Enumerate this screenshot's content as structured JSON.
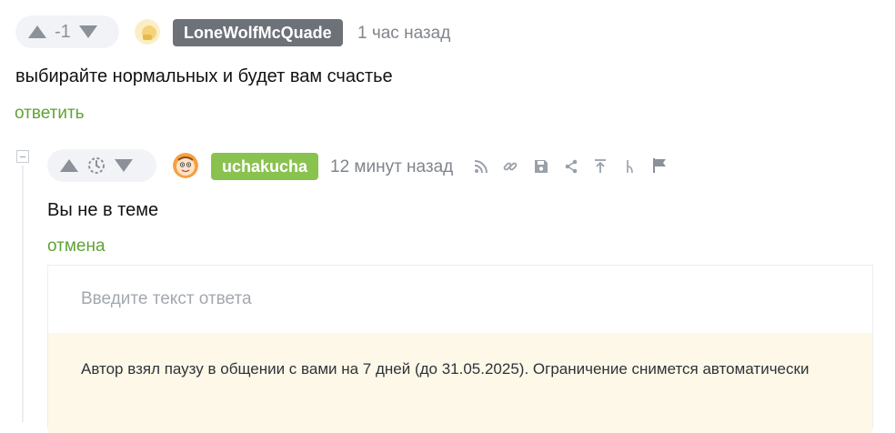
{
  "comment1": {
    "score": "-1",
    "author": "LoneWolfMcQuade",
    "time": "1 час назад",
    "text": "выбирайте нормальных и будет вам счастье",
    "reply_label": "ответить",
    "author_badge_color": "#6d7178"
  },
  "comment2": {
    "author": "uchakucha",
    "time": "12 минут назад",
    "text": "Вы не в теме",
    "cancel_label": "отмена",
    "author_badge_color": "#8ac250",
    "tools": [
      "rss-icon",
      "link-icon",
      "save-icon",
      "share-icon",
      "scroll-up-icon",
      "branch-icon",
      "flag-icon"
    ]
  },
  "reply_form": {
    "placeholder": "Введите текст ответа",
    "notice": "Автор взял паузу в общении с вами на 7 дней (до 31.05.2025). Ограничение снимется автоматически"
  },
  "colors": {
    "link": "#5fa335",
    "icon": "#8b9099"
  }
}
